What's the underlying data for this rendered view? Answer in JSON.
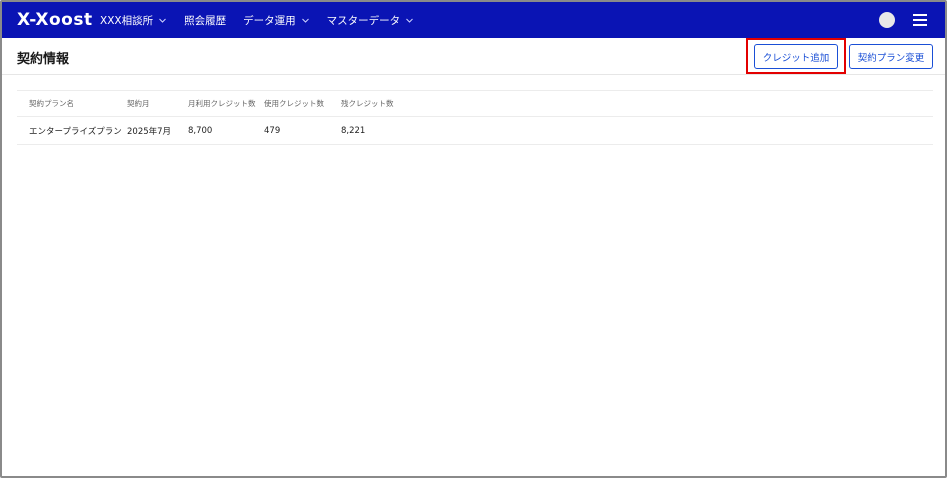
{
  "app": {
    "logo_text": "X-Xoost"
  },
  "nav": {
    "items": [
      {
        "label": "XXX相談所",
        "has_dropdown": true
      },
      {
        "label": "照会履歴",
        "has_dropdown": false
      },
      {
        "label": "データ運用",
        "has_dropdown": true
      },
      {
        "label": "マスターデータ",
        "has_dropdown": true
      }
    ]
  },
  "header": {
    "title": "契約情報",
    "credit_add_label": "クレジット追加",
    "plan_change_label": "契約プラン変更"
  },
  "table": {
    "columns": [
      "契約プラン名",
      "契約月",
      "月利用クレジット数",
      "使用クレジット数",
      "残クレジット数"
    ],
    "rows": [
      [
        "エンタープライズプラン",
        "2025年7月",
        "8,700",
        "479",
        "8,221"
      ]
    ]
  },
  "colors": {
    "navbar": "#0a14b4",
    "accent": "#1a4fd6",
    "highlight": "#e30000"
  },
  "icons": {
    "dropdown": "chevron-down-icon",
    "menu": "hamburger-menu-icon",
    "avatar": "avatar"
  }
}
